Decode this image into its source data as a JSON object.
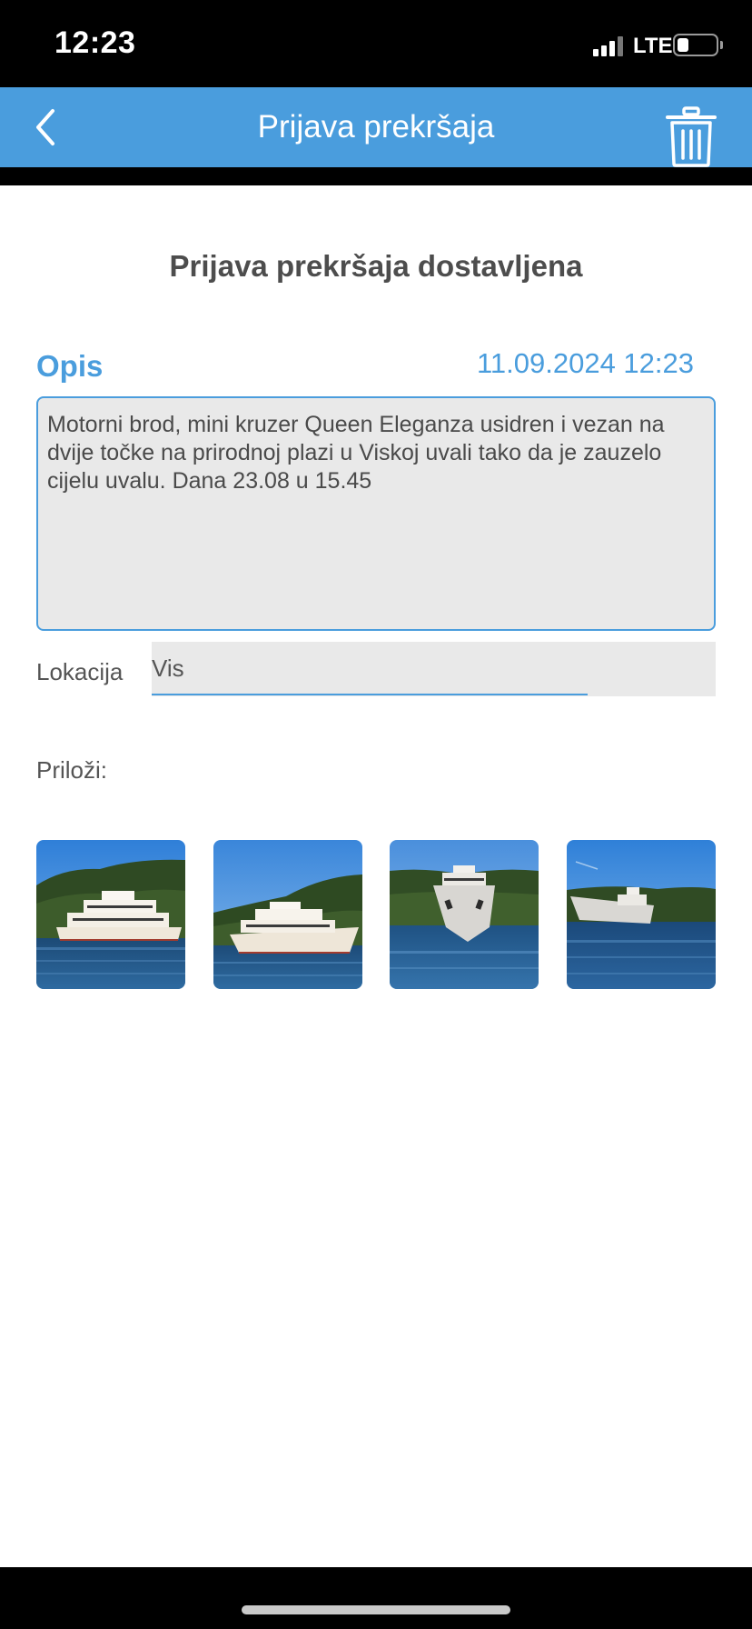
{
  "status_bar": {
    "time": "12:23",
    "network": "LTE"
  },
  "nav": {
    "title": "Prijava prekršaja"
  },
  "page": {
    "heading": "Prijava prekršaja dostavljena",
    "description_label": "Opis",
    "datetime": "11.09.2024 12:23",
    "description_text": "Motorni brod, mini kruzer Queen Eleganza usidren i vezan na dvije točke na prirodnoj plazi u Viskoj uvali tako da je zauzelo cijelu uvalu. Dana 23.08 u 15.45",
    "location_label": "Lokacija",
    "location_value": "Vis",
    "attachments_label": "Priloži:"
  },
  "colors": {
    "accent": "#4a9ddd",
    "text": "#4d4d4d",
    "field_bg": "#e9e9e9"
  }
}
